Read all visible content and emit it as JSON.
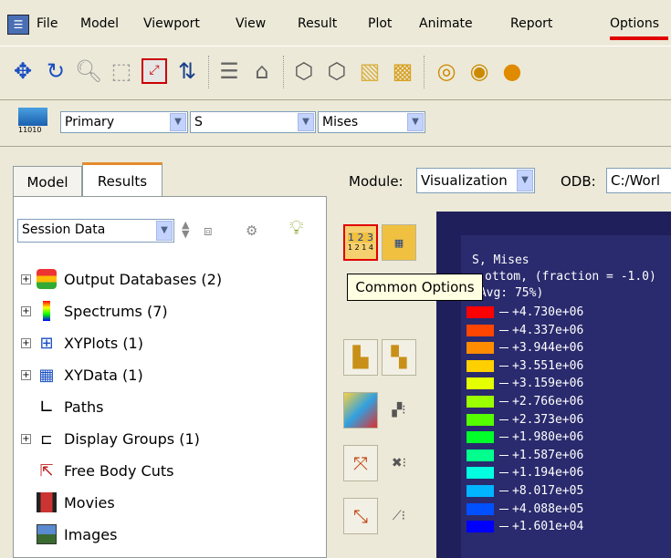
{
  "menu": [
    "File",
    "Model",
    "Viewport",
    "View",
    "Result",
    "Plot",
    "Animate",
    "Report",
    "Options"
  ],
  "field_output": {
    "position": "Primary",
    "variable": "S",
    "invariant": "Mises"
  },
  "tabs": [
    "Model",
    "Results"
  ],
  "session": {
    "selected": "Session Data"
  },
  "tree": [
    {
      "label": "Output Databases (2)",
      "expandable": true,
      "icon": "database-icon"
    },
    {
      "label": "Spectrums (7)",
      "expandable": true,
      "icon": "spectrum-icon"
    },
    {
      "label": "XYPlots (1)",
      "expandable": true,
      "icon": "xyplot-icon"
    },
    {
      "label": "XYData (1)",
      "expandable": true,
      "icon": "xydata-icon"
    },
    {
      "label": "Paths",
      "expandable": false,
      "icon": "path-icon"
    },
    {
      "label": "Display Groups (1)",
      "expandable": true,
      "icon": "display-group-icon"
    },
    {
      "label": "Free Body Cuts",
      "expandable": false,
      "icon": "free-body-cut-icon"
    },
    {
      "label": "Movies",
      "expandable": false,
      "icon": "movie-icon"
    },
    {
      "label": "Images",
      "expandable": false,
      "icon": "image-icon"
    }
  ],
  "module": {
    "label": "Module:",
    "value": "Visualization",
    "odb_label": "ODB:",
    "odb_value": "C:/Worl"
  },
  "tooltip": "Common Options",
  "tool_text": {
    "nums1": "1 2 3",
    "nums2": "1 2 1 4"
  },
  "legend": {
    "title": "S, Mises",
    "subtitle": "ottom, (fraction = -1.0)",
    "avg": "(Avg: 75%)",
    "entries": [
      {
        "value": "+4.730e+06",
        "color": "#ff0000"
      },
      {
        "value": "+4.337e+06",
        "color": "#ff4500"
      },
      {
        "value": "+3.944e+06",
        "color": "#ff8c00"
      },
      {
        "value": "+3.551e+06",
        "color": "#ffd000"
      },
      {
        "value": "+3.159e+06",
        "color": "#e3ff00"
      },
      {
        "value": "+2.766e+06",
        "color": "#9cff00"
      },
      {
        "value": "+2.373e+06",
        "color": "#55ff00"
      },
      {
        "value": "+1.980e+06",
        "color": "#00ff2a"
      },
      {
        "value": "+1.587e+06",
        "color": "#00ff8c"
      },
      {
        "value": "+1.194e+06",
        "color": "#00ffe0"
      },
      {
        "value": "+8.017e+05",
        "color": "#00b4ff"
      },
      {
        "value": "+4.088e+05",
        "color": "#0050ff"
      },
      {
        "value": "+1.601e+04",
        "color": "#0000ff"
      }
    ]
  }
}
